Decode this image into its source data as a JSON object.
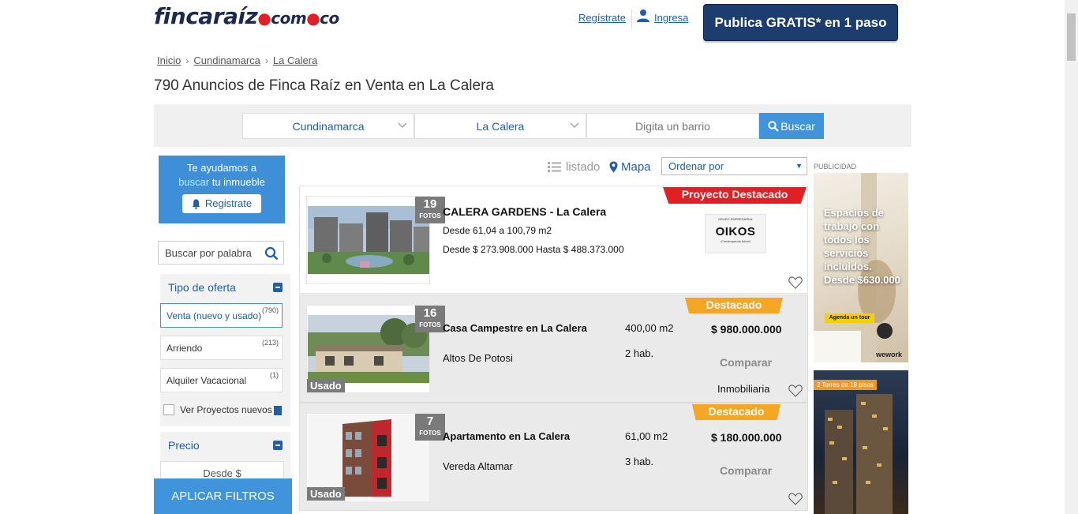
{
  "header": {
    "logo_main": "fincaraíz",
    "logo_sub_a": "com",
    "logo_sub_b": "co",
    "register_link": "Regístrate",
    "login_link": "Ingresa",
    "publish_button": "Publica GRATIS* en 1 paso"
  },
  "breadcrumb": [
    "Inicio",
    "Cundinamarca",
    "La Calera"
  ],
  "page_title": "790 Anuncios de Finca Raíz en Venta en La Calera",
  "search": {
    "department": "Cundinamarca",
    "city": "La Calera",
    "neighborhood_placeholder": "Digita un barrio",
    "button": "Buscar"
  },
  "sidebar": {
    "help_line1": "Te ayudamos a",
    "help_highlight": "buscar",
    "help_rest": " tu inmueble",
    "help_button": "Registrate",
    "keyword_placeholder": "Buscar por palabra",
    "offer_type_title": "Tipo de oferta",
    "offer_options": [
      {
        "label": "Venta (nuevo y usado)",
        "count": "(790)"
      },
      {
        "label": "Arriendo",
        "count": "(213)"
      },
      {
        "label": "Alquiler Vacacional",
        "count": "(1)"
      }
    ],
    "projects_checkbox": "Ver Proyectos nuevos",
    "price_title": "Precio",
    "price_from": "Desde $",
    "apply_button": "APLICAR FILTROS"
  },
  "view": {
    "list_label": "listado",
    "map_label": "Mapa",
    "sort_label": "Ordenar por"
  },
  "listings": [
    {
      "banner": "Proyecto Destacado",
      "photos": "19",
      "photos_label": "FOTOS",
      "title": "CALERA GARDENS - La Calera",
      "area_line": "Desde 61,04 a 100,79 m2",
      "price_line": "Desde $ 273.908.000 Hasta $ 488.373.000",
      "logo_text": "OIKOS",
      "logo_top": "GRUPO EMPRESARIAL",
      "logo_bottom": "¡Construyendo futuro!"
    },
    {
      "banner": "Destacado",
      "photos": "16",
      "photos_label": "FOTOS",
      "condition": "Usado",
      "title": "Casa Campestre en La Calera",
      "area": "400,00 m2",
      "price": "$ 980.000.000",
      "location": "Altos De Potosi",
      "rooms": "2 hab.",
      "compare": "Comparar",
      "seller": "Inmobiliaria"
    },
    {
      "banner": "Destacado",
      "photos": "7",
      "photos_label": "FOTOS",
      "condition": "Usado",
      "title": "Apartamento en La Calera",
      "area": "61,00 m2",
      "price": "$ 180.000.000",
      "location": "Vereda Altamar",
      "rooms": "3 hab.",
      "compare": "Comparar"
    }
  ],
  "ads": {
    "label": "PUBLICIDAD",
    "ad1_text": "Espacios de trabajo con todos los servicios incluidos. Desde $630.000",
    "ad1_cta": "Agenda un tour",
    "ad1_brand": "wework",
    "ad2_tag": "2 Torres de 18 pisos"
  },
  "colors": {
    "primary_blue": "#1f5ea8",
    "button_blue": "#3f94dc",
    "navy": "#1c3d6e",
    "featured_red": "#e31e24",
    "featured_orange": "#f5a623"
  }
}
